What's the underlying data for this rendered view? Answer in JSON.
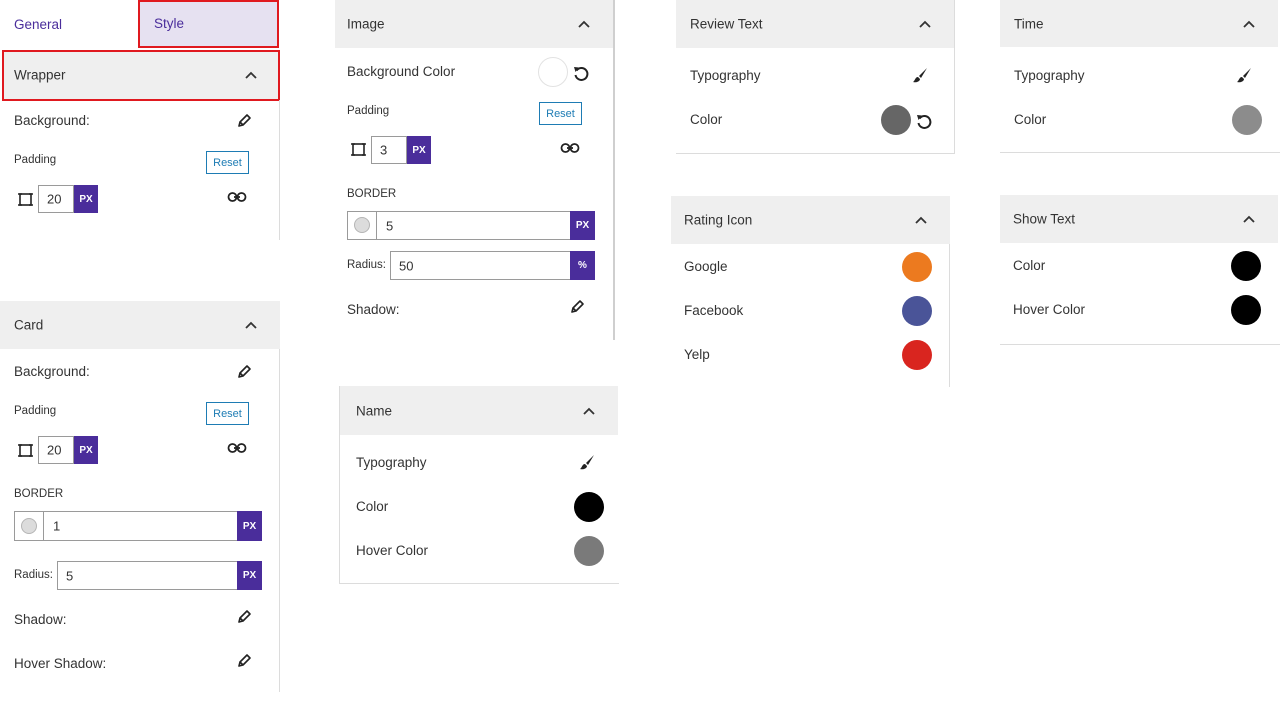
{
  "tabs": {
    "general": "General",
    "style": "Style"
  },
  "wrapper": {
    "title": "Wrapper",
    "background_label": "Background:",
    "padding_label": "Padding",
    "reset_label": "Reset",
    "padding_value": "20",
    "unit": "PX"
  },
  "card": {
    "title": "Card",
    "background_label": "Background:",
    "padding_label": "Padding",
    "reset_label": "Reset",
    "padding_value": "20",
    "unit": "PX",
    "border_label": "BORDER",
    "border_value": "1",
    "radius_label": "Radius:",
    "radius_value": "5",
    "shadow_label": "Shadow:",
    "hover_shadow_label": "Hover Shadow:"
  },
  "image": {
    "title": "Image",
    "bg_color_label": "Background Color",
    "padding_label": "Padding",
    "reset_label": "Reset",
    "padding_value": "3",
    "unit": "PX",
    "border_label": "BORDER",
    "border_value": "5",
    "radius_label": "Radius:",
    "radius_value": "50",
    "radius_unit": "%",
    "shadow_label": "Shadow:",
    "bg_color": "#ffffff"
  },
  "name": {
    "title": "Name",
    "typography_label": "Typography",
    "color_label": "Color",
    "hover_color_label": "Hover Color",
    "color": "#000000",
    "hover_color": "#7a7a7a"
  },
  "review_text": {
    "title": "Review Text",
    "typography_label": "Typography",
    "color_label": "Color",
    "color": "#666666"
  },
  "rating_icon": {
    "title": "Rating Icon",
    "items": [
      {
        "label": "Google",
        "color": "#ec7a1f"
      },
      {
        "label": "Facebook",
        "color": "#4a5498"
      },
      {
        "label": "Yelp",
        "color": "#d9251f"
      }
    ]
  },
  "time": {
    "title": "Time",
    "typography_label": "Typography",
    "color_label": "Color",
    "color": "#8c8c8c"
  },
  "show_text": {
    "title": "Show Text",
    "color_label": "Color",
    "hover_color_label": "Hover Color",
    "color": "#000000",
    "hover_color": "#000000"
  },
  "colors": {
    "accent": "#4a2d9b",
    "highlight": "#e0191f",
    "reset_blue": "#1e7cb4",
    "header_bg": "#efefef"
  },
  "icons": [
    "pencil-icon",
    "link-icon",
    "padding-box-icon",
    "chevron-up-icon",
    "brush-icon",
    "undo-icon"
  ]
}
